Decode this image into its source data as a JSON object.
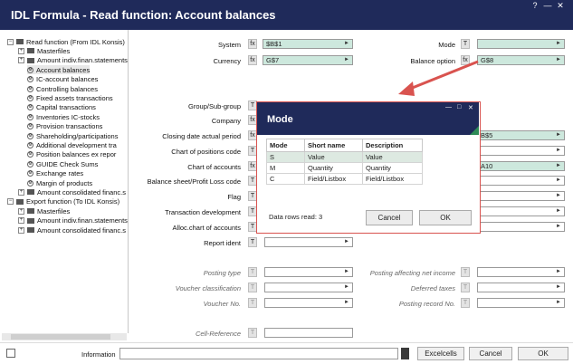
{
  "window": {
    "title": "IDL Formula - Read function: Account balances"
  },
  "tree": {
    "items": [
      {
        "label": "Read function (From IDL Konsis)",
        "type": "root"
      },
      {
        "label": "Masterfiles",
        "type": "folder"
      },
      {
        "label": "Amount indiv.finan.statements",
        "type": "folder"
      },
      {
        "label": "Account balances",
        "type": "leaf"
      },
      {
        "label": "IC-account balances",
        "type": "leaf"
      },
      {
        "label": "Controlling balances",
        "type": "leaf"
      },
      {
        "label": "Fixed assets transactions",
        "type": "leaf"
      },
      {
        "label": "Capital transactions",
        "type": "leaf"
      },
      {
        "label": "Inventories IC-stocks",
        "type": "leaf"
      },
      {
        "label": "Provision transactions",
        "type": "leaf"
      },
      {
        "label": "Shareholding/participations",
        "type": "leaf"
      },
      {
        "label": "Additional development tra",
        "type": "leaf"
      },
      {
        "label": "Position balances ex repor",
        "type": "leaf"
      },
      {
        "label": "GUIDE Check Sums",
        "type": "leaf"
      },
      {
        "label": "Exchange rates",
        "type": "leaf"
      },
      {
        "label": "Margin of products",
        "type": "leaf"
      },
      {
        "label": "Amount consolidated financ.s",
        "type": "folder"
      },
      {
        "label": "Export function (To IDL Konsis)",
        "type": "root"
      },
      {
        "label": "Masterfiles",
        "type": "folder"
      },
      {
        "label": "Amount indiv.finan.statements",
        "type": "folder"
      },
      {
        "label": "Amount consolidated financ.s",
        "type": "folder"
      }
    ]
  },
  "form": {
    "system": {
      "label": "System",
      "value": "$B$1"
    },
    "currency": {
      "label": "Currency",
      "value": "G$7"
    },
    "mode": {
      "label": "Mode",
      "value": ""
    },
    "balance_option": {
      "label": "Balance option",
      "value": "G$8"
    },
    "group_subgroup": {
      "label": "Group/Sub-group"
    },
    "company": {
      "label": "Company"
    },
    "closing_date": {
      "label": "Closing date actual period",
      "value": "B$5"
    },
    "chart_positions": {
      "label": "Chart of positions code"
    },
    "chart_accounts": {
      "label": "Chart of accounts",
      "value": "A10"
    },
    "balance_sheet": {
      "label": "Balance sheet/Profit  Loss code"
    },
    "flag": {
      "label": "Flag"
    },
    "transaction_dev": {
      "label": "Transaction development"
    },
    "alloc_chart": {
      "label": "Alloc.chart of accounts"
    },
    "report_ident": {
      "label": "Report ident"
    },
    "posting_type": {
      "label": "Posting type"
    },
    "voucher_class": {
      "label": "Voucher classification"
    },
    "voucher_no": {
      "label": "Voucher No."
    },
    "posting_affecting": {
      "label": "Posting affecting net income"
    },
    "deferred_taxes": {
      "label": "Deferred taxes"
    },
    "posting_record": {
      "label": "Posting record No."
    },
    "cell_reference": {
      "label": "Cell-Reference"
    },
    "fx": "fx",
    "t": "T"
  },
  "dialog": {
    "title": "Mode",
    "columns": [
      "Mode",
      "Short name",
      "Description"
    ],
    "rows": [
      [
        "S",
        "Value",
        "Value"
      ],
      [
        "M",
        "Quantity",
        "Quantity"
      ],
      [
        "C",
        "Field/Listbox",
        "Field/Listbox"
      ]
    ],
    "rows_read": "Data rows read: 3",
    "cancel": "Cancel",
    "ok": "OK"
  },
  "footer": {
    "information": "Information",
    "excelcells": "Excelcells",
    "cancel": "Cancel",
    "ok": "OK"
  }
}
